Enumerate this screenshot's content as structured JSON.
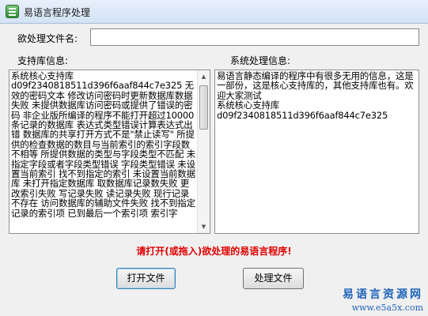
{
  "window": {
    "title": "易语言程序处理"
  },
  "form": {
    "filename_label": "欲处理文件名:",
    "filename_value": "",
    "support_label": "支持库信息:",
    "system_label": "系统处理信息:"
  },
  "support_lib_text": "系统核心支持库\nd09f2340818511d396f6aaf844c7e325 无效的密码文本 修改访问密码时更新数据库数据失败 未提供数据库访问密码或提供了错误的密码 非企业版所编译的程序不能打开超过10000条记录的数据库 表达式类型错误计算表达式出错 数据库的共享打开方式不是\"禁止读写\" 所提供的检查数据的数目与当前索引的索引字段数不相等 所提供数据的类型与字段类型不匹配 未指定字段或者字段类型错误 字段类型错误 未设置当前索引 找不到指定的索引 未设置当前数据库 未打开指定数据库 取数据库记录数失败 更改索引失败 写记录失败 读记录失败 现行记录不存在 访问数据库的辅助文件失败 找不到指定记录的索引项 已到最后一个索引项 索引字",
  "system_info_text": "易语言静态编译的程序中有很多无用的信息，这是一部份，这是核心支持库的，其他支持库也有。欢迎大家测试\n系统核心支持库\nd09f2340818511d396f6aaf844c7e325",
  "status_message": "请打开(或拖入)欲处理的易语言程序!",
  "buttons": {
    "open": "打开文件",
    "process": "处理文件"
  },
  "watermark": {
    "name": "易语言资源网",
    "url": "www.e5a5x.com"
  },
  "colors": {
    "status": "#e00000",
    "watermark": "#1e63b8"
  }
}
